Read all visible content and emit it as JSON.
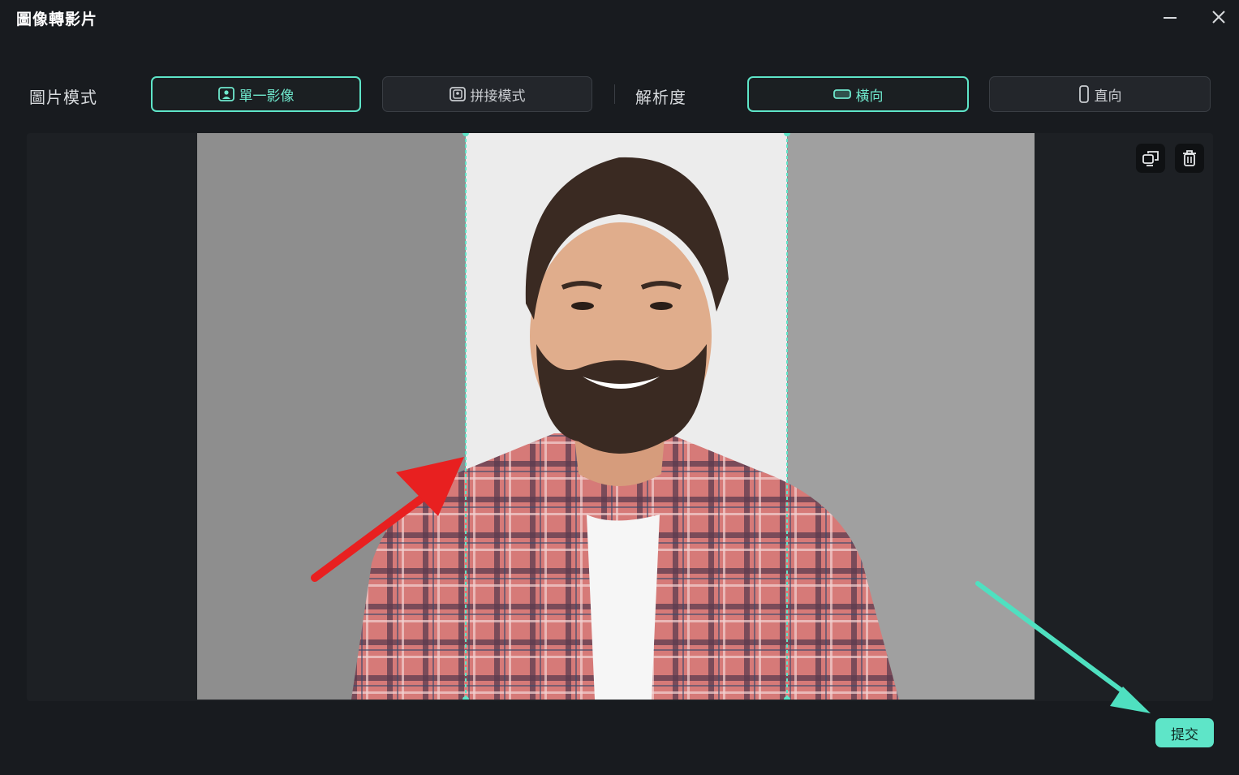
{
  "window": {
    "title": "圖像轉影片",
    "minimize_icon": "minimize-icon",
    "close_icon": "close-icon"
  },
  "image_mode": {
    "label": "圖片模式",
    "options": [
      {
        "label": "單一影像",
        "icon": "single-image-icon",
        "selected": true
      },
      {
        "label": "拼接模式",
        "icon": "collage-icon",
        "selected": false
      }
    ]
  },
  "resolution": {
    "label": "解析度",
    "options": [
      {
        "label": "橫向",
        "icon": "landscape-icon",
        "selected": true
      },
      {
        "label": "直向",
        "icon": "portrait-icon",
        "selected": false
      }
    ]
  },
  "preview": {
    "tools": [
      "replace-icon",
      "trash-icon"
    ]
  },
  "submit_label": "提交",
  "colors": {
    "accent": "#5ee5c8",
    "background": "#181b1f",
    "annotation_red": "#e82020",
    "annotation_teal": "#4fe0c0"
  }
}
